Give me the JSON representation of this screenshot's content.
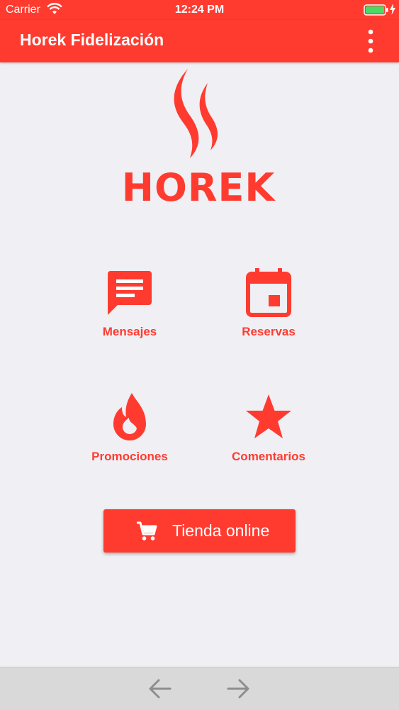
{
  "status_bar": {
    "carrier": "Carrier",
    "time": "12:24 PM"
  },
  "app_bar": {
    "title": "Horek Fidelización"
  },
  "logo": {
    "text": "HOREK"
  },
  "menu": {
    "items": [
      {
        "label": "Mensajes",
        "icon": "message-icon"
      },
      {
        "label": "Reservas",
        "icon": "calendar-icon"
      },
      {
        "label": "Promociones",
        "icon": "flame-icon"
      },
      {
        "label": "Comentarios",
        "icon": "star-icon"
      }
    ]
  },
  "shop_button": {
    "label": "Tienda online",
    "icon": "cart-icon"
  },
  "colors": {
    "accent": "#ff3b30",
    "background": "#efeff4",
    "bottom_bar": "#d9d9d9"
  }
}
